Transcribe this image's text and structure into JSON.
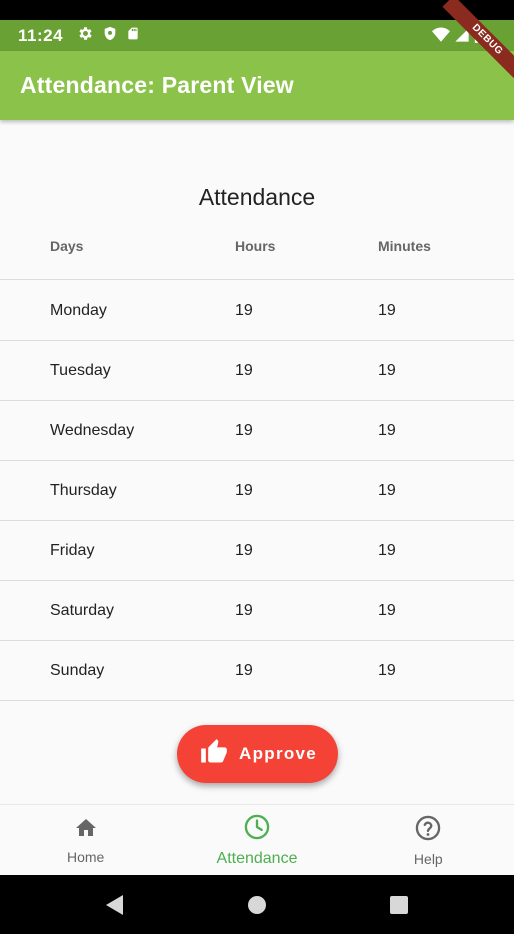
{
  "status_bar": {
    "time": "11:24",
    "icons": [
      "gear-icon",
      "shield-icon",
      "sd-card-icon",
      "wifi-icon",
      "signal-icon",
      "battery-icon"
    ]
  },
  "app_bar": {
    "title": "Attendance: Parent View",
    "color": "#8bc34a"
  },
  "debug_banner": "DEBUG",
  "attendance": {
    "title": "Attendance",
    "columns": [
      "Days",
      "Hours",
      "Minutes"
    ],
    "rows": [
      {
        "day": "Monday",
        "hours": "19",
        "minutes": "19"
      },
      {
        "day": "Tuesday",
        "hours": "19",
        "minutes": "19"
      },
      {
        "day": "Wednesday",
        "hours": "19",
        "minutes": "19"
      },
      {
        "day": "Thursday",
        "hours": "19",
        "minutes": "19"
      },
      {
        "day": "Friday",
        "hours": "19",
        "minutes": "19"
      },
      {
        "day": "Saturday",
        "hours": "19",
        "minutes": "19"
      },
      {
        "day": "Sunday",
        "hours": "19",
        "minutes": "19"
      }
    ]
  },
  "approve_button": {
    "label": "Approve",
    "icon": "thumbs-up-icon",
    "color": "#f44336"
  },
  "bottom_nav": {
    "items": [
      {
        "label": "Home",
        "icon": "home-icon",
        "active": false
      },
      {
        "label": "Attendance",
        "icon": "clock-icon",
        "active": true
      },
      {
        "label": "Help",
        "icon": "help-icon",
        "active": false
      }
    ],
    "active_color": "#4caf50"
  },
  "system_nav": [
    "back-icon",
    "home-circle-icon",
    "recents-icon"
  ]
}
